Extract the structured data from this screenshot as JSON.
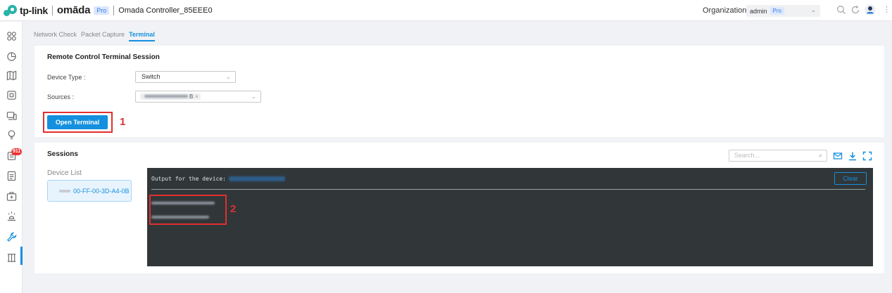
{
  "header": {
    "brand": "tp-link",
    "product": "omāda",
    "product_badge": "Pro",
    "controller_name": "Omada Controller_85EEE0",
    "org_label": "Organization:",
    "org_value": "admin",
    "org_badge": "Pro"
  },
  "sidebar": {
    "items": [
      {
        "icon": "dashboard-icon"
      },
      {
        "icon": "statistics-icon"
      },
      {
        "icon": "map-icon"
      },
      {
        "icon": "devices-icon"
      },
      {
        "icon": "clients-icon"
      },
      {
        "icon": "insight-icon"
      },
      {
        "icon": "alerts-icon",
        "badge": "911"
      },
      {
        "icon": "logs-icon"
      },
      {
        "icon": "report-icon"
      },
      {
        "icon": "hotspot-icon"
      },
      {
        "icon": "tools-icon",
        "active": true
      },
      {
        "icon": "audit-icon"
      }
    ]
  },
  "tabs": [
    "Network Check",
    "Packet Capture",
    "Terminal"
  ],
  "remote": {
    "title": "Remote Control Terminal Session",
    "device_type_label": "Device Type :",
    "device_type_value": "Switch",
    "sources_label": "Sources :",
    "sources_chip_suffix": "B",
    "sources_chip_close": "×",
    "open_button": "Open Terminal",
    "annotation_1": "1"
  },
  "sessions": {
    "title": "Sessions",
    "search_placeholder": "Search...",
    "device_list_label": "Device List",
    "device_name": "00-FF-00-3D-A4-0B",
    "output_label": "Output for the device:",
    "clear_button": "Clear",
    "annotation_2": "2"
  },
  "colors": {
    "accent": "#1490de",
    "annotation": "#e03030",
    "terminal_bg": "#313639"
  }
}
